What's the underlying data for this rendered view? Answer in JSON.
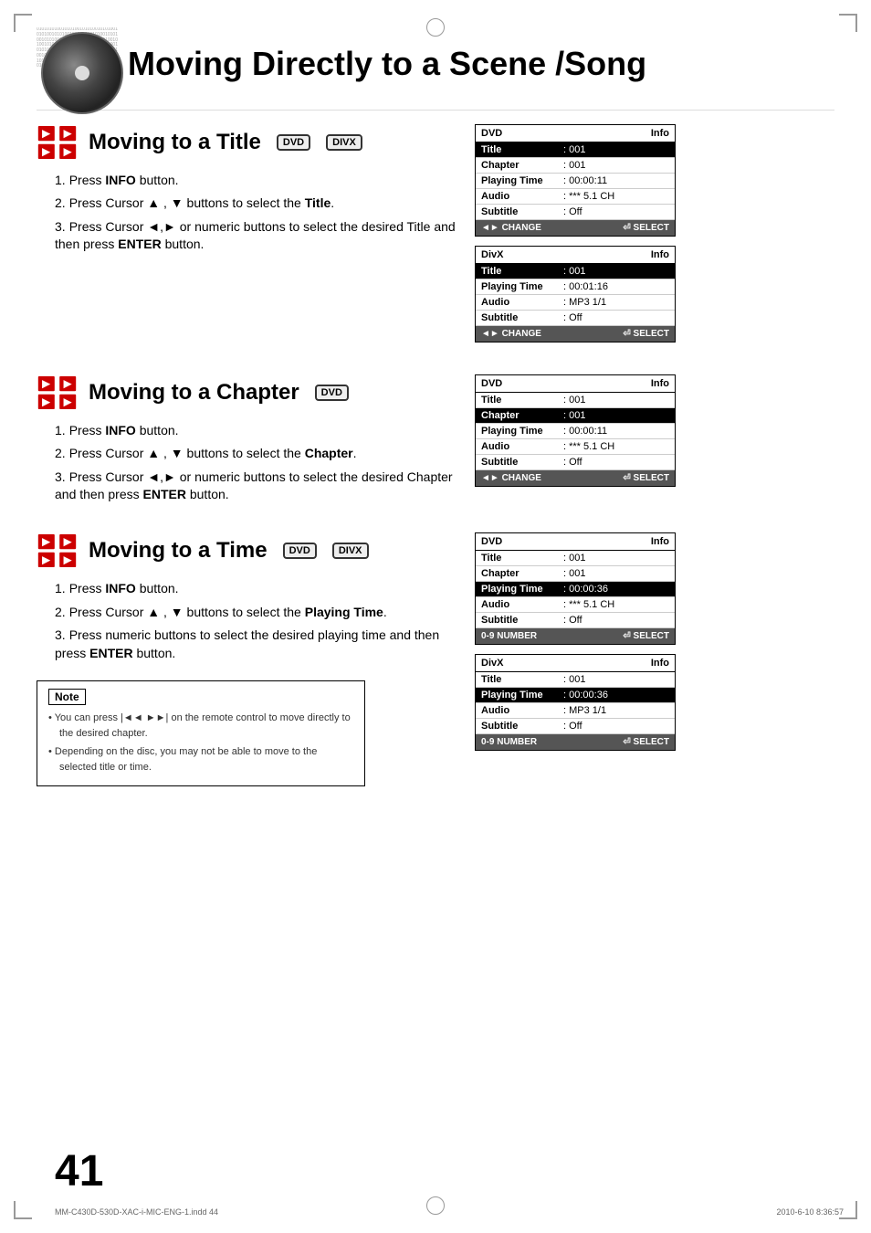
{
  "page": {
    "title": "Moving Directly to a Scene /Song",
    "number": "41",
    "footer_left": "MM-C430D-530D-XAC-i-MIC-ENG-1.indd   44",
    "footer_right": "2010-6-10   8:36:57"
  },
  "sections": [
    {
      "id": "title",
      "heading": "Moving to a Title",
      "badges": [
        "DVD",
        "DIVX"
      ],
      "steps": [
        {
          "num": "1",
          "text": "Press ",
          "bold": "INFO",
          "text2": " button."
        },
        {
          "num": "2",
          "text": "Press Cursor ▲ , ▼ buttons to select the ",
          "bold": "Title",
          "text2": "."
        },
        {
          "num": "3",
          "text": "Press Cursor ◄,► or numeric buttons to select the desired Title and then press ",
          "bold": "ENTER",
          "text2": " button."
        }
      ],
      "panels": [
        {
          "type": "DVD",
          "label_right": "Info",
          "rows": [
            {
              "label": "Title",
              "value": ": 001",
              "highlight": true
            },
            {
              "label": "Chapter",
              "value": ": 001",
              "highlight": false
            },
            {
              "label": "Playing Time",
              "value": ": 00:00:11",
              "highlight": false
            },
            {
              "label": "Audio",
              "value": ": *** 5.1 CH",
              "highlight": false
            },
            {
              "label": "Subtitle",
              "value": ": Off",
              "highlight": false
            }
          ],
          "footer_left": "◄► CHANGE",
          "footer_right": "⏎ SELECT"
        },
        {
          "type": "DivX",
          "label_right": "Info",
          "rows": [
            {
              "label": "Title",
              "value": ": 001",
              "highlight": true
            },
            {
              "label": "Playing Time",
              "value": ": 00:01:16",
              "highlight": false
            },
            {
              "label": "Audio",
              "value": ": MP3 1/1",
              "highlight": false
            },
            {
              "label": "Subtitle",
              "value": ": Off",
              "highlight": false
            }
          ],
          "footer_left": "◄► CHANGE",
          "footer_right": "⏎ SELECT"
        }
      ]
    },
    {
      "id": "chapter",
      "heading": "Moving to a Chapter",
      "badges": [
        "DVD"
      ],
      "steps": [
        {
          "num": "1",
          "text": "Press ",
          "bold": "INFO",
          "text2": " button."
        },
        {
          "num": "2",
          "text": "Press Cursor ▲ , ▼ buttons to select the ",
          "bold": "Chapter",
          "text2": "."
        },
        {
          "num": "3",
          "text": "Press Cursor ◄,► or numeric buttons to select the desired Chapter and then press ",
          "bold": "ENTER",
          "text2": " button."
        }
      ],
      "panels": [
        {
          "type": "DVD",
          "label_right": "Info",
          "rows": [
            {
              "label": "Title",
              "value": ": 001",
              "highlight": false
            },
            {
              "label": "Chapter",
              "value": ": 001",
              "highlight": true
            },
            {
              "label": "Playing Time",
              "value": ": 00:00:11",
              "highlight": false
            },
            {
              "label": "Audio",
              "value": ": *** 5.1 CH",
              "highlight": false
            },
            {
              "label": "Subtitle",
              "value": ": Off",
              "highlight": false
            }
          ],
          "footer_left": "◄► CHANGE",
          "footer_right": "⏎ SELECT"
        }
      ]
    },
    {
      "id": "time",
      "heading": "Moving to a Time",
      "badges": [
        "DVD",
        "DIVX"
      ],
      "steps": [
        {
          "num": "1",
          "text": "Press ",
          "bold": "INFO",
          "text2": " button."
        },
        {
          "num": "2",
          "text": "Press Cursor ▲ , ▼ buttons to select the ",
          "bold": "Playing Time",
          "text2": "."
        },
        {
          "num": "3",
          "text": "Press numeric buttons to select the desired playing time and then press ",
          "bold": "ENTER",
          "text2": " button."
        }
      ],
      "panels": [
        {
          "type": "DVD",
          "label_right": "Info",
          "rows": [
            {
              "label": "Title",
              "value": ": 001",
              "highlight": false
            },
            {
              "label": "Chapter",
              "value": ": 001",
              "highlight": false
            },
            {
              "label": "Playing Time",
              "value": ": 00:00:36",
              "highlight": true
            },
            {
              "label": "Audio",
              "value": ": *** 5.1 CH",
              "highlight": false
            },
            {
              "label": "Subtitle",
              "value": ": Off",
              "highlight": false
            }
          ],
          "footer_left": "0-9 NUMBER",
          "footer_right": "⏎ SELECT"
        },
        {
          "type": "DivX",
          "label_right": "Info",
          "rows": [
            {
              "label": "Title",
              "value": ": 001",
              "highlight": false
            },
            {
              "label": "Playing Time",
              "value": ": 00:00:36",
              "highlight": true
            },
            {
              "label": "Audio",
              "value": ": MP3 1/1",
              "highlight": false
            },
            {
              "label": "Subtitle",
              "value": ": Off",
              "highlight": false
            }
          ],
          "footer_left": "0-9 NUMBER",
          "footer_right": "⏎ SELECT"
        }
      ]
    }
  ],
  "note": {
    "label": "Note",
    "bullets": [
      "You can press |◄◄ ►►| on the remote control to move directly to the desired chapter.",
      "Depending on the disc, you may not be able to move to the selected title or time."
    ]
  },
  "binary_pattern": "0101010101010101010101010101010101010101010101010101010101010101010101010101010101010101010101010101010101010101010101010101"
}
